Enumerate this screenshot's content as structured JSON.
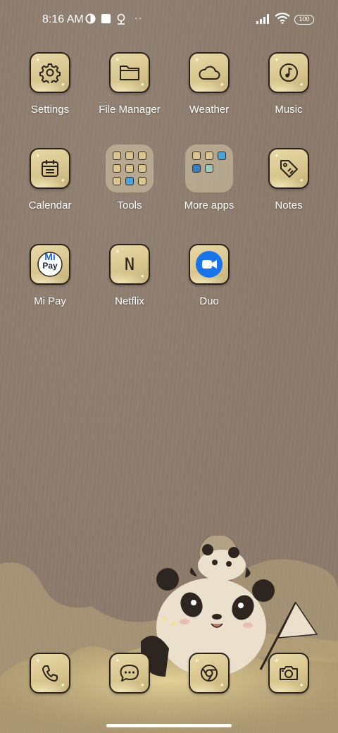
{
  "status_bar": {
    "time": "8:16 AM",
    "battery": "100"
  },
  "apps": [
    {
      "label": "Settings",
      "icon": "gear-icon"
    },
    {
      "label": "File Manager",
      "icon": "folder-icon"
    },
    {
      "label": "Weather",
      "icon": "cloud-icon"
    },
    {
      "label": "Music",
      "icon": "music-note-icon"
    },
    {
      "label": "Calendar",
      "icon": "calendar-icon"
    },
    {
      "label": "Tools",
      "icon": "folder-grid-icon"
    },
    {
      "label": "More apps",
      "icon": "folder-grid-icon"
    },
    {
      "label": "Notes",
      "icon": "tag-icon"
    },
    {
      "label": "Mi Pay",
      "icon": "mi-pay-icon",
      "badge_top": "Mi",
      "badge_bottom": "Pay"
    },
    {
      "label": "Netflix",
      "icon": "netflix-icon",
      "glyph": "N"
    },
    {
      "label": "Duo",
      "icon": "video-camera-icon"
    }
  ],
  "dock": [
    {
      "name": "phone",
      "icon": "phone-icon"
    },
    {
      "name": "messages",
      "icon": "chat-bubble-icon"
    },
    {
      "name": "chrome",
      "icon": "chrome-icon"
    },
    {
      "name": "camera",
      "icon": "camera-icon"
    }
  ],
  "colors": {
    "wallpaper": "#8c7b6c",
    "icon_face": "#d8c68e",
    "icon_outline": "#2a231c",
    "label_text": "#ffffff",
    "duo_blue": "#1a73e8"
  }
}
